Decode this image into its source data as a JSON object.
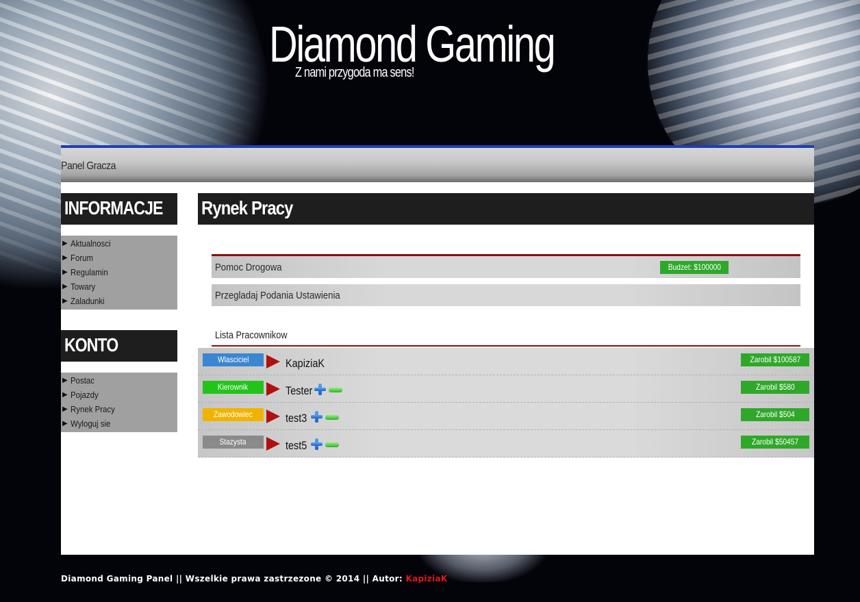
{
  "header": {
    "title": "Diamond Gaming",
    "tagline": "Z nami przygoda ma sens!"
  },
  "panel": {
    "title": "Panel Gracza"
  },
  "sidebar": {
    "info_heading": "INFORMACJE",
    "info_items": [
      {
        "label": "Aktualnosci"
      },
      {
        "label": "Forum"
      },
      {
        "label": "Regulamin"
      },
      {
        "label": "Towary"
      },
      {
        "label": "Zaladunki"
      }
    ],
    "account_heading": "KONTO",
    "account_items": [
      {
        "label": "Postac"
      },
      {
        "label": "Pojazdy"
      },
      {
        "label": "Rynek Pracy"
      },
      {
        "label": "Wyloguj sie"
      }
    ]
  },
  "main": {
    "heading": "Rynek Pracy",
    "job_name": "Pomoc Drogowa",
    "budget": "Budzet: $100000",
    "job_actions": "Przegladaj Podania Ustawienia",
    "workers_label": "Lista Pracownikow",
    "workers": [
      {
        "role": "Wlasciciel",
        "role_color": "#3a86d1",
        "name": "KapiziaK",
        "earned": "Zarobil $100587",
        "controls": false
      },
      {
        "role": "Kierownik",
        "role_color": "#22c41a",
        "name": "Tester",
        "earned": "Zarobil $580",
        "controls": true
      },
      {
        "role": "Zawodowiec",
        "role_color": "#f0b400",
        "name": "test3",
        "earned": "Zarobil $504",
        "controls": true
      },
      {
        "role": "Stazysta",
        "role_color": "#8a8a8a",
        "name": "test5",
        "earned": "Zarobil $50457",
        "controls": true
      }
    ]
  },
  "footer": {
    "text": "Diamond Gaming Panel || Wszelkie prawa zastrzezone © 2014 || Autor: ",
    "author": "KapiziaK"
  },
  "colors": {
    "accent_blue": "#1f3fb0",
    "badge_green": "#2fa82a",
    "divider_red": "#8e0c0c",
    "author_red": "#e01818"
  }
}
